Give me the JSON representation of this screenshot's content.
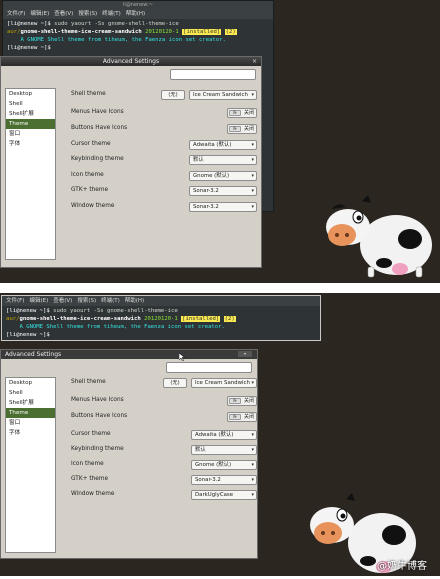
{
  "shots": [
    {
      "terminal": {
        "title": "li@nenew:~",
        "menu": [
          "文件(F)",
          "编辑(E)",
          "查看(V)",
          "搜索(S)",
          "终端(T)",
          "帮助(H)"
        ],
        "prompt1": "[li@nenew ~]$",
        "cmd": "sudo yaourt -Ss gnome-shell-theme-ice",
        "repo": "aur/",
        "pkg": "gnome-shell-theme-ice-cream-sandwich",
        "version": "20120120-1",
        "installed": "[installed]",
        "votes": "(2)",
        "desc": "    A GNOME Shell theme from tiheum, the Faenza icon set creator.",
        "prompt2": "[li@nenew ~]$"
      },
      "window": {
        "title": "Advanced Settings",
        "close": "×",
        "sidebar": [
          "Desktop",
          "Shell",
          "Shell扩展",
          "Theme",
          "窗口",
          "字体"
        ],
        "active_index": 3,
        "rows": [
          {
            "label": "Shell theme",
            "kind": "shell",
            "none": "(无)",
            "value": "Ice Cream Sandwich"
          },
          {
            "label": "Menus Have Icons",
            "kind": "toggle",
            "knob": "⊪",
            "value": "关闭"
          },
          {
            "label": "Buttons Have Icons",
            "kind": "toggle",
            "knob": "⊪",
            "value": "关闭"
          },
          {
            "label": "Cursor theme",
            "kind": "combo",
            "value": "Adwaita (默认)"
          },
          {
            "label": "Keybinding theme",
            "kind": "combo",
            "value": "默认"
          },
          {
            "label": "Icon theme",
            "kind": "combo",
            "value": "Gnome (默认)"
          },
          {
            "label": "GTK+ theme",
            "kind": "combo",
            "value": "Sonar-3.2"
          },
          {
            "label": "Window theme",
            "kind": "combo",
            "value": "Sonar-3.2"
          }
        ]
      }
    },
    {
      "terminal": {
        "title": "",
        "menu": [
          "文件(F)",
          "编辑(E)",
          "查看(V)",
          "搜索(S)",
          "终端(T)",
          "帮助(H)"
        ],
        "prompt1": "[li@nenew ~]$",
        "cmd": "sudo yaourt -Ss gnome-shell-theme-ice",
        "repo": "aur/",
        "pkg": "gnome-shell-theme-ice-cream-sandwich",
        "version": "20120120-1",
        "installed": "[installed]",
        "votes": "(2)",
        "desc": "    A GNOME Shell theme from tiheum, the Faenza icon set creator.",
        "prompt2": "[li@nenew ~]$"
      },
      "window": {
        "title": "Advanced Settings",
        "close": "▾",
        "sidebar": [
          "Desktop",
          "Shell",
          "Shell扩展",
          "Theme",
          "窗口",
          "字体"
        ],
        "active_index": 3,
        "rows": [
          {
            "label": "Shell theme",
            "kind": "shell",
            "none": "(无)",
            "value": "Ice Cream Sandwich"
          },
          {
            "label": "Menus Have Icons",
            "kind": "toggle",
            "knob": "⊪",
            "value": "关闭"
          },
          {
            "label": "Buttons Have Icons",
            "kind": "toggle",
            "knob": "⊪",
            "value": "关闭"
          },
          {
            "label": "Cursor theme",
            "kind": "combo",
            "value": "Adwaita (默认)"
          },
          {
            "label": "Keybinding theme",
            "kind": "combo",
            "value": "默认"
          },
          {
            "label": "Icon theme",
            "kind": "combo",
            "value": "Gnome (默认)"
          },
          {
            "label": "GTK+ theme",
            "kind": "combo",
            "value": "Sonar-3.2"
          },
          {
            "label": "Window theme",
            "kind": "combo",
            "value": "DarkUglyCase"
          }
        ]
      }
    }
  ],
  "watermark": "@奶牛博客",
  "colors": {
    "desktop": "#2c2621",
    "terminal": "#2e3436",
    "selection": "#4a6f31",
    "highlight": "#fce94f"
  }
}
